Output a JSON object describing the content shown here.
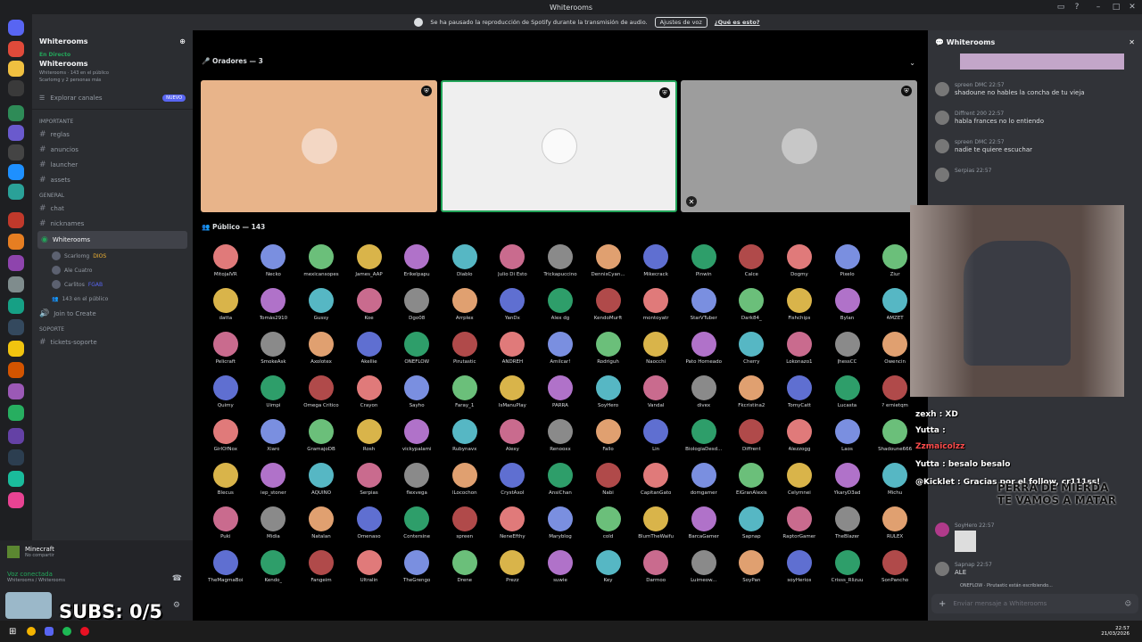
{
  "window": {
    "title": "Whiterooms"
  },
  "banner": {
    "text": "Se ha pausado la reproducción de Spotify durante la transmisión de audio.",
    "button": "Ajustes de voz",
    "link": "¿Qué es esto?"
  },
  "server": {
    "name": "Whiterooms",
    "live_label": "En Directo",
    "room_title": "Whiterooms",
    "room_meta": "Whiterooms · 143 en el público",
    "room_members": "Scarlomg y 2 personas más",
    "explore": "Explorar canales",
    "new_badge": "NUEVO"
  },
  "categories": [
    {
      "name": "IMPORTANTE",
      "channels": [
        "reglas",
        "anuncios",
        "launcher",
        "assets"
      ]
    },
    {
      "name": "GENERAL",
      "channels": [
        "chat",
        "nicknames"
      ]
    }
  ],
  "active_channel": {
    "name": "Whiterooms",
    "sub": "Whiterooms"
  },
  "stage_members": [
    {
      "name": "Scarlomg",
      "tag": "DIOS"
    },
    {
      "name": "Ale Cuatro",
      "tag": ""
    },
    {
      "name": "Carlitos",
      "tag": "FGAB"
    }
  ],
  "audience_count": "143 en el público",
  "join_create": "Join to Create",
  "support": {
    "name": "SOPORTE",
    "channels": [
      "tickets-soporte"
    ]
  },
  "activity": {
    "game": "Minecraft",
    "status": "No compartir"
  },
  "voice": {
    "status": "Voz conectada",
    "location": "Whiterooms / Whiterooms"
  },
  "subs": "SUBS: 0/5",
  "speakers_header": "Oradores — 3",
  "public_header": "Público — 143",
  "audience": [
    "MitojalVR",
    "Necko",
    "mexicansopes",
    "James_AAP",
    "Erikelpapu",
    "Diablo",
    "Julio Di Esto",
    "Trickapuccino",
    "DennisCyan...",
    "Mikecrack",
    "Pinwin",
    "Calce",
    "Dogmy",
    "Pixelo",
    "Ziur",
    "datta",
    "Tomás2910",
    "Gussy",
    "Koe",
    "Dgo08",
    "Arrplex",
    "YanDx",
    "Alex dg",
    "KendoMurft",
    "montoyatr",
    "StarVTuber",
    "Dark84_",
    "Fishchips",
    "Bylan",
    "AMZET",
    "Pelicraft",
    "SmokeAsk",
    "Axolotex",
    "Akellie",
    "ONEFLOW",
    "Pirutastic",
    "ANDREH",
    "Amilcar!",
    "Rodriguh",
    "Naocchi",
    "Pato Horneado",
    "Cherry",
    "Lokonazo1",
    "JhessCC",
    "Owencin",
    "Quimy",
    "Uimpi",
    "Omega Crítico",
    "Crayon",
    "Sayho",
    "Faray_1",
    "IsManuPlay",
    "PARRA",
    "SoyHero",
    "Vandal",
    "divex",
    "Fkcristina2",
    "TomyCatt",
    "Lucasta",
    "? ernietqm",
    "GirlOfNox",
    "Xiaro",
    "GramajoDB",
    "Rosh",
    "vickypalami",
    "Rubynavx",
    "Alexy",
    "Renooxx",
    "Fallo",
    "Lin",
    "BiologiaDesd...",
    "Diffrent",
    "Alezzogg",
    "Laos",
    "Shadoune666",
    "Blecus",
    "iep_stoner",
    "AQUINO",
    "Serpias",
    "flexvega",
    "lLocochon",
    "CrystAxol",
    "AnsiChan",
    "Nabi",
    "CapitanGato",
    "domgamer",
    "ElGranAlexis",
    "Celymnei",
    "YkaryD3ad",
    "Michu",
    "Puki",
    "Midia",
    "Natalan",
    "Omenaso",
    "Contersine",
    "spreen",
    "NeneEfthy",
    "Maryblog",
    "cold",
    "BlumTheWaifu",
    "BarcaGamer",
    "Sapnap",
    "RaptorGamer",
    "TheBlazer",
    "RULEX",
    "TheMagmaBoi",
    "Kendo_",
    "Fangeim",
    "Ultralin",
    "TheGrengo",
    "Drene",
    "Prezz",
    "suwie",
    "Key",
    "Darmoo",
    "Luimeow...",
    "SoyPan",
    "soyHerios",
    "Crisss_Rlizuu",
    "SonPancho"
  ],
  "chat": {
    "title": "Whiterooms",
    "input_placeholder": "Enviar mensaje a Whiterooms",
    "messages": [
      {
        "user": "spreen",
        "tag": "DMC",
        "time": "22:57",
        "text": "shadoune no hables la concha de tu vieja"
      },
      {
        "user": "Diffrent",
        "tag": "200",
        "time": "22:57",
        "text": "habla frances no lo entiendo"
      },
      {
        "user": "spreen",
        "tag": "DMC",
        "time": "22:57",
        "text": "nadie te quiere escuchar"
      },
      {
        "user": "Serpias",
        "tag": "",
        "time": "22:57",
        "text": ""
      },
      {
        "user": "SoyHero",
        "tag": "",
        "time": "22:57",
        "text": ""
      },
      {
        "user": "Sapnap",
        "tag": "",
        "time": "22:57",
        "text": "ALE"
      }
    ],
    "typing": "ONEFLOW · Pirutastic están escribiendo..."
  },
  "overlay": [
    "zexh : XD",
    "Yutta :",
    "Zzmaicolzz",
    "Yutta : besalo besalo",
    "@Kicklet : Gracias por el follow, cr111ss!",
    "PERRA DE MIERDA",
    "TE VAMOS A MATAR"
  ],
  "taskbar": {
    "time": "22:57",
    "date": "21/03/2026"
  }
}
